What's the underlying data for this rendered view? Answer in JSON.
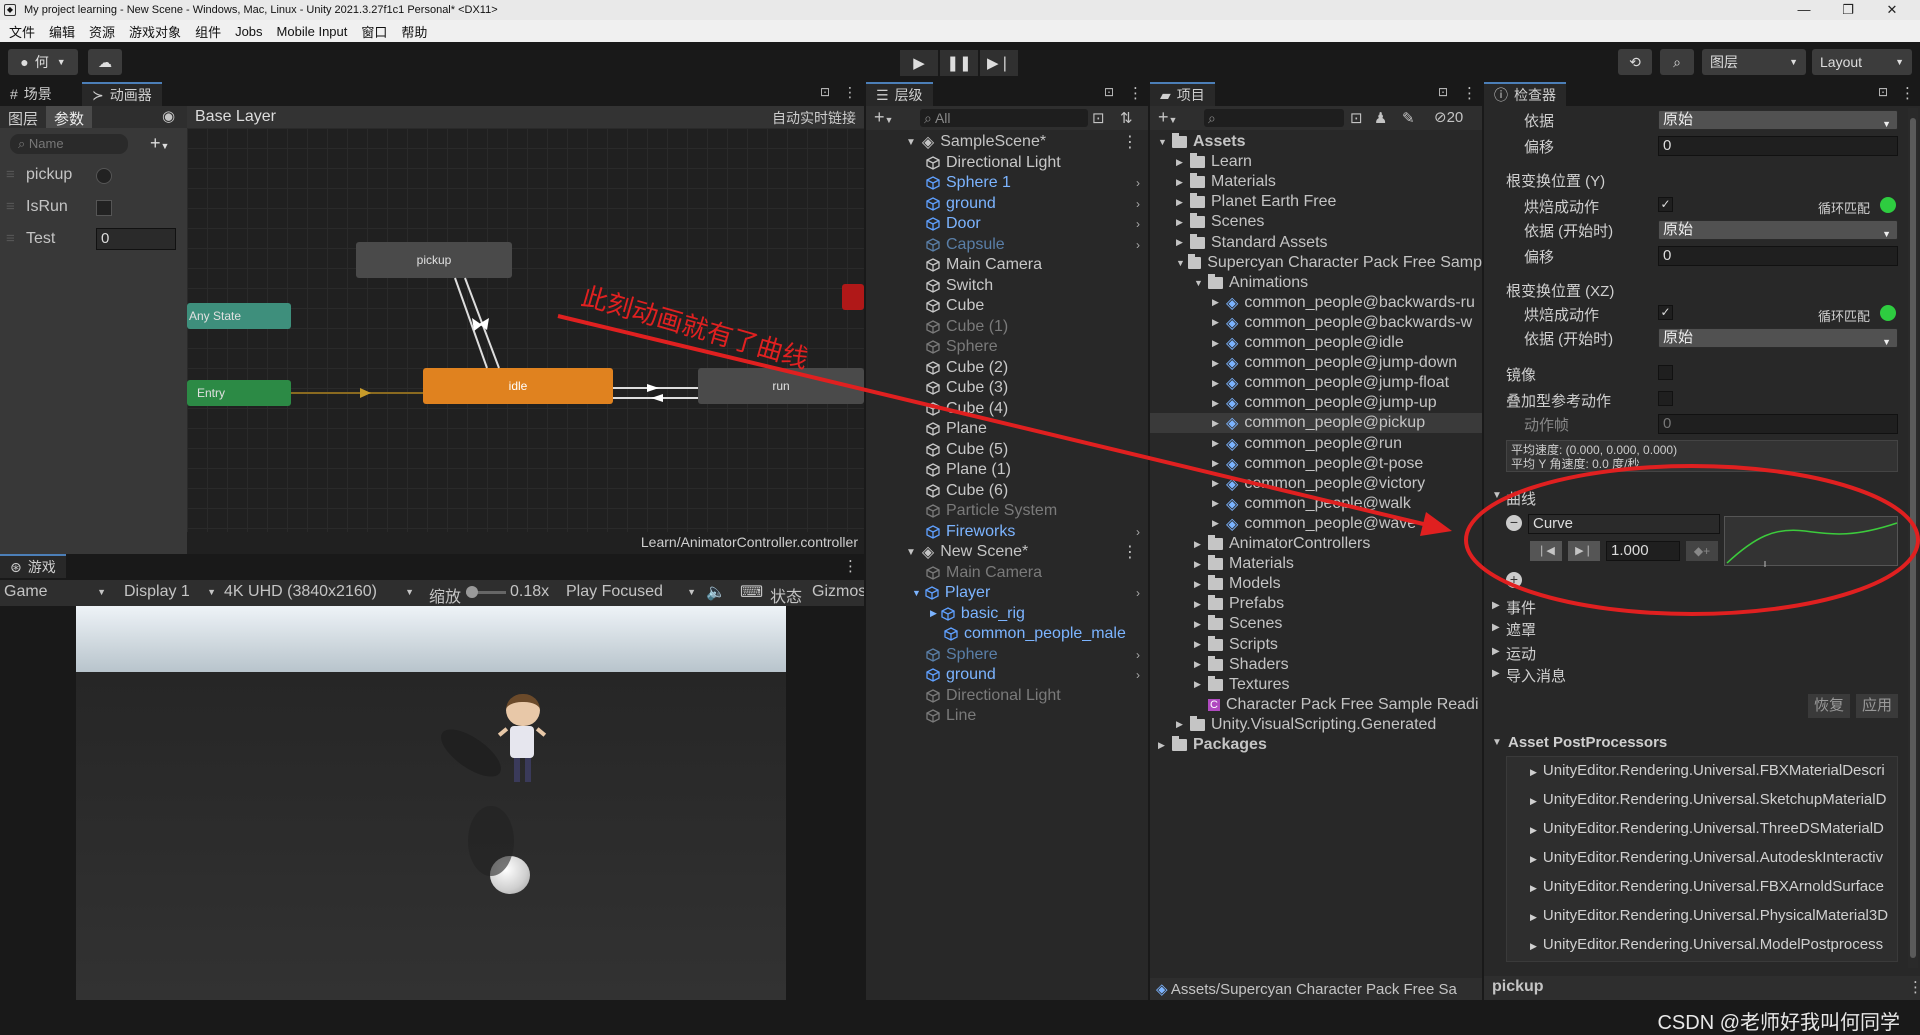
{
  "window": {
    "title": "My project learning - New Scene - Windows, Mac, Linux - Unity 2021.3.27f1c1 Personal* <DX11>"
  },
  "menu": [
    "文件",
    "编辑",
    "资源",
    "游戏对象",
    "组件",
    "Jobs",
    "Mobile Input",
    "窗口",
    "帮助"
  ],
  "toolbar": {
    "account": "何",
    "layers": "图层",
    "layout": "Layout"
  },
  "animator": {
    "tab_scene": "场景",
    "tab_animator": "动画器",
    "sub_layers": "图层",
    "sub_params": "参数",
    "breadcrumb": "Base Layer",
    "autolive": "自动实时链接",
    "search_placeholder": "Name",
    "params": [
      {
        "name": "pickup",
        "kind": "trigger"
      },
      {
        "name": "IsRun",
        "kind": "bool"
      },
      {
        "name": "Test",
        "kind": "float",
        "value": "0"
      }
    ],
    "nodes": {
      "pickup": "pickup",
      "any": "Any State",
      "entry": "Entry",
      "idle": "idle",
      "run": "run"
    },
    "footer": "Learn/AnimatorController.controller",
    "annotation": "此刻动画就有了曲线"
  },
  "game": {
    "tab": "游戏",
    "mode": "Game",
    "display": "Display 1",
    "resolution": "4K UHD (3840x2160)",
    "scale_label": "缩放",
    "scale_value": "0.18x",
    "play_focused": "Play Focused",
    "stats": "状态",
    "gizmos": "Gizmos"
  },
  "hierarchy": {
    "tab": "层级",
    "search_placeholder": "All",
    "scene1": "SampleScene*",
    "scene1_items": [
      {
        "label": "Directional Light",
        "style": "normal",
        "arrow": false
      },
      {
        "label": "Sphere 1",
        "style": "blue",
        "arrow": true
      },
      {
        "label": "ground",
        "style": "blue",
        "arrow": true
      },
      {
        "label": "Door",
        "style": "blue",
        "arrow": true
      },
      {
        "label": "Capsule",
        "style": "dimblue",
        "arrow": true
      },
      {
        "label": "Main Camera",
        "style": "normal",
        "arrow": false
      },
      {
        "label": "Switch",
        "style": "normal",
        "arrow": false
      },
      {
        "label": "Cube",
        "style": "normal",
        "arrow": false
      },
      {
        "label": "Cube (1)",
        "style": "dim",
        "arrow": false
      },
      {
        "label": "Sphere",
        "style": "dim",
        "arrow": false
      },
      {
        "label": "Cube (2)",
        "style": "normal",
        "arrow": false
      },
      {
        "label": "Cube (3)",
        "style": "normal",
        "arrow": false
      },
      {
        "label": "Cube (4)",
        "style": "normal",
        "arrow": false
      },
      {
        "label": "Plane",
        "style": "normal",
        "arrow": false
      },
      {
        "label": "Cube (5)",
        "style": "normal",
        "arrow": false
      },
      {
        "label": "Plane (1)",
        "style": "normal",
        "arrow": false
      },
      {
        "label": "Cube (6)",
        "style": "normal",
        "arrow": false
      },
      {
        "label": "Particle System",
        "style": "dim",
        "arrow": false
      },
      {
        "label": "Fireworks",
        "style": "blue",
        "arrow": true
      }
    ],
    "scene2": "New Scene*",
    "scene2_items": [
      {
        "label": "Main Camera",
        "style": "dim",
        "indent": 0,
        "arrow": false
      },
      {
        "label": "Player",
        "style": "blue",
        "indent": 0,
        "arrow": true
      },
      {
        "label": "basic_rig",
        "style": "blue",
        "indent": 1,
        "arrow": false
      },
      {
        "label": "common_people_male",
        "style": "blue",
        "indent": 1,
        "arrow": false
      },
      {
        "label": "Sphere",
        "style": "dimblue",
        "indent": 0,
        "arrow": true
      },
      {
        "label": "ground",
        "style": "blue",
        "indent": 0,
        "arrow": true
      },
      {
        "label": "Directional Light",
        "style": "dim",
        "indent": 0,
        "arrow": false
      },
      {
        "label": "Line",
        "style": "dim",
        "indent": 0,
        "arrow": false
      }
    ]
  },
  "project": {
    "tab": "项目",
    "hidden_count": "20",
    "tree": [
      {
        "label": "Assets",
        "level": 0,
        "type": "folder",
        "bold": true
      },
      {
        "label": "Learn",
        "level": 1,
        "type": "folder"
      },
      {
        "label": "Materials",
        "level": 1,
        "type": "folder"
      },
      {
        "label": "Planet Earth Free",
        "level": 1,
        "type": "folder"
      },
      {
        "label": "Scenes",
        "level": 1,
        "type": "folder"
      },
      {
        "label": "Standard Assets",
        "level": 1,
        "type": "folder"
      },
      {
        "label": "Supercyan Character Pack Free Samp",
        "level": 1,
        "type": "folder"
      },
      {
        "label": "Animations",
        "level": 2,
        "type": "folder"
      },
      {
        "label": "common_people@backwards-ru",
        "level": 3,
        "type": "model"
      },
      {
        "label": "common_people@backwards-w",
        "level": 3,
        "type": "model"
      },
      {
        "label": "common_people@idle",
        "level": 3,
        "type": "model"
      },
      {
        "label": "common_people@jump-down",
        "level": 3,
        "type": "model"
      },
      {
        "label": "common_people@jump-float",
        "level": 3,
        "type": "model"
      },
      {
        "label": "common_people@jump-up",
        "level": 3,
        "type": "model"
      },
      {
        "label": "common_people@pickup",
        "level": 3,
        "type": "model",
        "selected": true
      },
      {
        "label": "common_people@run",
        "level": 3,
        "type": "model"
      },
      {
        "label": "common_people@t-pose",
        "level": 3,
        "type": "model"
      },
      {
        "label": "common_people@victory",
        "level": 3,
        "type": "model"
      },
      {
        "label": "common_people@walk",
        "level": 3,
        "type": "model"
      },
      {
        "label": "common_people@wave",
        "level": 3,
        "type": "model"
      },
      {
        "label": "AnimatorControllers",
        "level": 2,
        "type": "folder"
      },
      {
        "label": "Materials",
        "level": 2,
        "type": "folder"
      },
      {
        "label": "Models",
        "level": 2,
        "type": "folder"
      },
      {
        "label": "Prefabs",
        "level": 2,
        "type": "folder"
      },
      {
        "label": "Scenes",
        "level": 2,
        "type": "folder"
      },
      {
        "label": "Scripts",
        "level": 2,
        "type": "folder"
      },
      {
        "label": "Shaders",
        "level": 2,
        "type": "folder"
      },
      {
        "label": "Textures",
        "level": 2,
        "type": "folder"
      },
      {
        "label": "Character Pack Free Sample Readi",
        "level": 2,
        "type": "doc"
      },
      {
        "label": "Unity.VisualScripting.Generated",
        "level": 1,
        "type": "folder"
      },
      {
        "label": "Packages",
        "level": 0,
        "type": "folder",
        "bold": true
      }
    ],
    "footer": "Assets/Supercyan Character Pack Free Sa"
  },
  "inspector": {
    "tab": "检查器",
    "basis_label": "依据",
    "basis_value": "原始",
    "offset_label": "偏移",
    "offset_value": "0",
    "rootY_header": "根变换位置 (Y)",
    "bake_label": "烘焙成动作",
    "loopmatch_label": "循环匹配",
    "basis_start_label": "依据 (开始时)",
    "basis_start_value": "原始",
    "offsetY_value": "0",
    "rootXZ_header": "根变换位置 (XZ)",
    "bake_xz_label": "烘焙成动作",
    "loopmatch_xz_label": "循环匹配",
    "basis_start_xz_label": "依据 (开始时)",
    "basis_start_xz_value": "原始",
    "mirror_label": "镜像",
    "additive_label": "叠加型参考动作",
    "frame_label": "动作帧",
    "frame_value": "0",
    "avg_velocity": "平均速度: (0.000, 0.000, 0.000)",
    "avg_angular": "平均 Y 角速度: 0.0 度/秒",
    "curves_header": "曲线",
    "curve_name": "Curve",
    "curve_value": "1.000",
    "events": "事件",
    "mask": "遮罩",
    "motion": "运动",
    "import_messages": "导入消息",
    "revert": "恢复",
    "apply": "应用",
    "postprocessors_header": "Asset PostProcessors",
    "postprocessors": [
      "UnityEditor.Rendering.Universal.FBXMaterialDescri",
      "UnityEditor.Rendering.Universal.SketchupMaterialD",
      "UnityEditor.Rendering.Universal.ThreeDSMaterialD",
      "UnityEditor.Rendering.Universal.AutodeskInteractiv",
      "UnityEditor.Rendering.Universal.FBXArnoldSurface",
      "UnityEditor.Rendering.Universal.PhysicalMaterial3D",
      "UnityEditor.Rendering.Universal.ModelPostprocess"
    ],
    "preview_title": "pickup"
  },
  "watermark": "CSDN @老师好我叫何同学",
  "colors": {
    "accent": "#4c7fb8",
    "idle_node": "#e0821f",
    "entry_node": "#2c8a45",
    "anystate_node": "#3e8f7c",
    "annotation": "#e02020"
  }
}
